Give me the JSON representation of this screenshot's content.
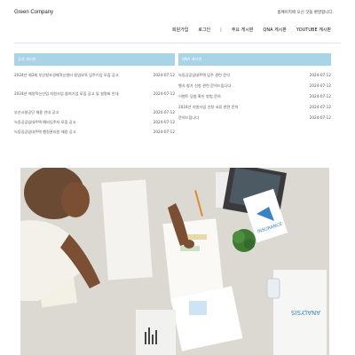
{
  "header": {
    "brand": "Green Company",
    "welcome": "홈페이지에 오신 것을 환영합니다.",
    "nav": {
      "join": "회원가입",
      "login": "로그인",
      "separator": "|",
      "board_main": "주요 게시판",
      "board_qna": "QNA 게시판",
      "board_youtube": "YOUTUBE 게시판"
    }
  },
  "notice": {
    "title": "공지 게시판",
    "items": [
      {
        "title": "2024년 제3회 부산창조경제혁신센터 창업보육 입주기업 모집 공고",
        "date": "2024-07-12"
      },
      {
        "title": "2024년 해양혁신산업 지원사업 참여기업 모집 공고 및 설명회 안내",
        "date": "2024-07-12"
      },
      {
        "title": "부산시설공단 채용 안내 공고",
        "date": "2024-07-12"
      },
      {
        "title": "녹동공공임대주택 예비입주자 모집 공고",
        "date": "2024-07-12"
      },
      {
        "title": "녹동공공임대주택 행정관리원 채용 공고",
        "date": "2024-07-12"
      }
    ]
  },
  "qna": {
    "title": "QNA 게시판",
    "items": [
      {
        "title": "녹동공공임대주택 입주 관련 문의",
        "date": "2024-07-12"
      },
      {
        "title": "행사 참가 신청 관련 문의드립니다",
        "date": "2024-07-12"
      },
      {
        "title": "이벤트 당첨 확인 방법 문의",
        "date": "2024-07-12"
      },
      {
        "title": "2024년 지원사업 신청 서류 관련 문의",
        "date": "2024-07-12"
      },
      {
        "title": "문의드립니다",
        "date": "2024-07-12"
      }
    ]
  },
  "hero": {
    "image": "office-desk-documents-photo",
    "card_texts": [
      "INSURANCE",
      "ANALYSIS"
    ]
  }
}
